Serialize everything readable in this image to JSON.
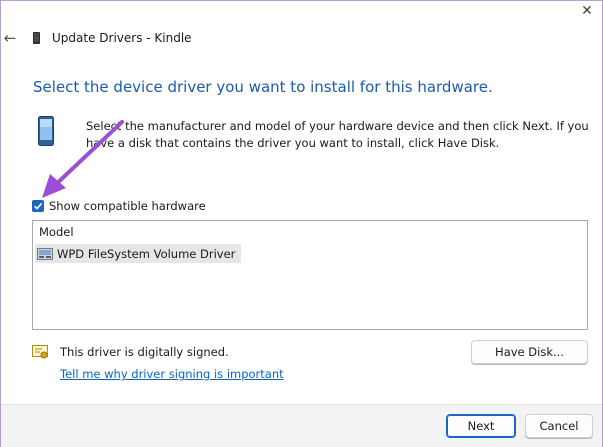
{
  "window": {
    "title": "Update Drivers - Kindle",
    "close_glyph": "✕",
    "back_glyph": "←"
  },
  "main": {
    "heading": "Select the device driver you want to install for this hardware.",
    "intro": "Select the manufacturer and model of your hardware device and then click Next. If you have a disk that contains the driver you want to install, click Have Disk.",
    "show_compatible_label": "Show compatible hardware",
    "show_compatible_checked": true
  },
  "list": {
    "column_header": "Model",
    "items": [
      {
        "label": "WPD FileSystem Volume Driver",
        "selected": true
      }
    ]
  },
  "signing": {
    "status_text": "This driver is digitally signed.",
    "link_text": "Tell me why driver signing is important"
  },
  "buttons": {
    "have_disk": "Have Disk...",
    "next": "Next",
    "cancel": "Cancel"
  },
  "colors": {
    "heading": "#1c5bb0",
    "accent": "#1d65c4",
    "link": "#0b63c9",
    "annotation_arrow": "#9a4fd6"
  },
  "icons": {
    "back": "back-arrow-icon",
    "close": "close-icon",
    "device": "kindle-device-icon",
    "hardware": "hardware-device-icon",
    "driver": "driver-icon",
    "signed": "signed-certificate-icon"
  }
}
